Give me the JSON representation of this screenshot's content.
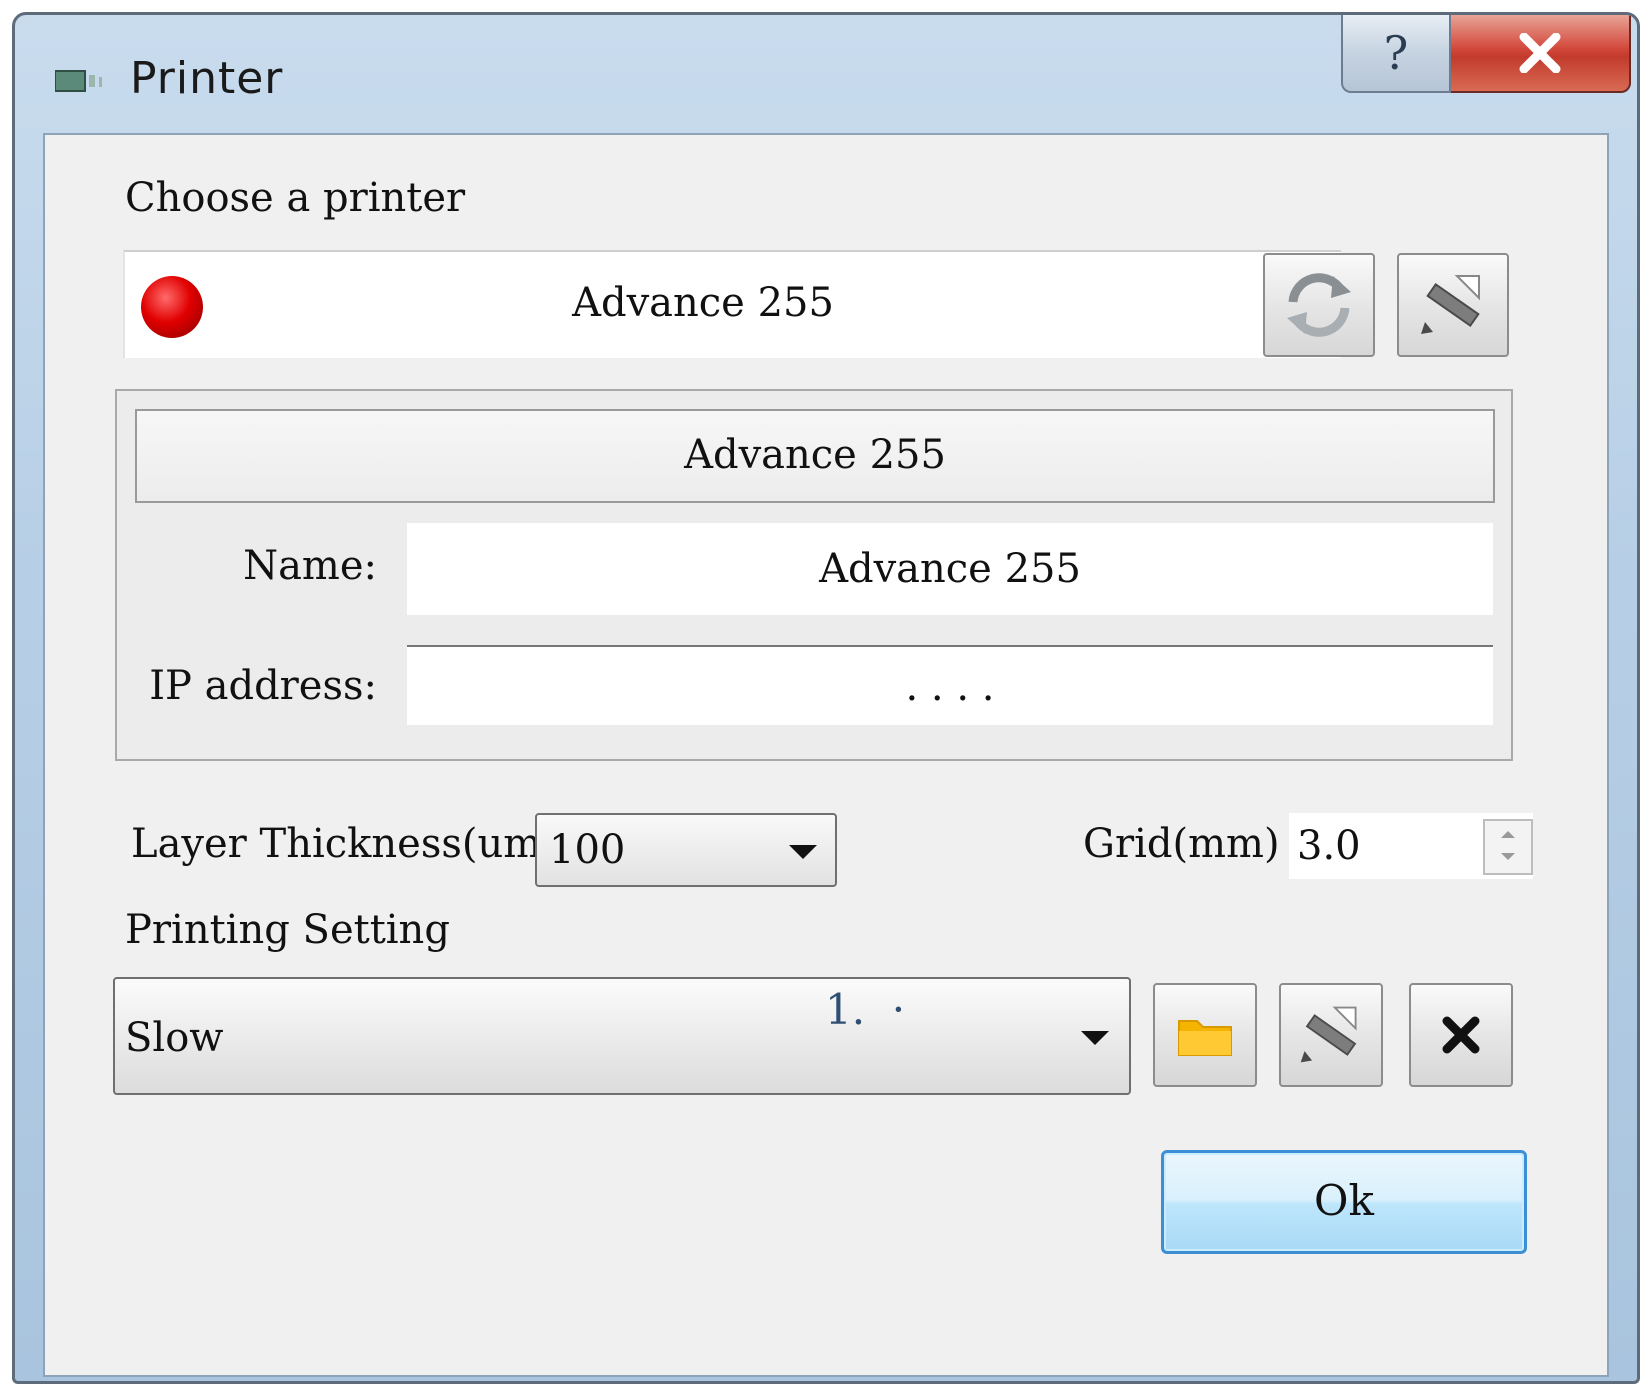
{
  "window": {
    "title": "Printer",
    "help_glyph": "?",
    "close_glyph": "✕"
  },
  "printer": {
    "section_label": "Choose a printer",
    "selected": "Advance 255",
    "status_color": "#e00000"
  },
  "info": {
    "header": "Advance 255",
    "name_label": "Name:",
    "name_value": "Advance 255",
    "ip_label": "IP address:",
    "ip_value": ". . . ."
  },
  "layer": {
    "label": "Layer Thickness(um)",
    "value": "100"
  },
  "grid": {
    "label": "Grid(mm)",
    "value": "3.0"
  },
  "printing": {
    "label": "Printing Setting",
    "value": "Slow",
    "annotation": "1.  ·"
  },
  "buttons": {
    "ok_label": "Ok"
  },
  "colors": {
    "ok_border": "#3c8fd4",
    "close_button": "#c23b2d",
    "folder": "#f5b400"
  }
}
